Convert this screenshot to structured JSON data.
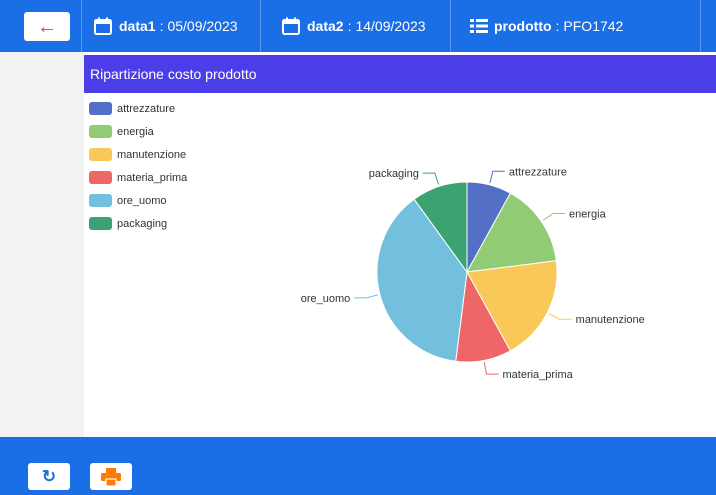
{
  "toolbar": {
    "back_icon": "arrow-left-icon",
    "date1": {
      "label": "data1",
      "value": "05/09/2023",
      "icon": "calendar-icon"
    },
    "date2": {
      "label": "data2",
      "value": "14/09/2023",
      "icon": "calendar-icon"
    },
    "product": {
      "label": "prodotto",
      "value": "PFO1742",
      "icon": "list-icon"
    }
  },
  "panel": {
    "title": "Ripartizione costo prodotto"
  },
  "chart_data": {
    "type": "pie",
    "title": "",
    "legend_placement": "top-left",
    "slices": [
      {
        "name": "attrezzature",
        "value": 8,
        "color": "#5470c6"
      },
      {
        "name": "energia",
        "value": 15,
        "color": "#91cc75"
      },
      {
        "name": "manutenzione",
        "value": 19,
        "color": "#fac858"
      },
      {
        "name": "materia_prima",
        "value": 10,
        "color": "#ee6666"
      },
      {
        "name": "ore_uomo",
        "value": 38,
        "color": "#73c0de"
      },
      {
        "name": "packaging",
        "value": 10,
        "color": "#3ba272"
      }
    ]
  },
  "footer": {
    "refresh_icon": "refresh-icon",
    "print_icon": "print-icon"
  },
  "colors": {
    "primary": "#1a6ee6",
    "header": "#4b3de8",
    "back_arrow": "#e53935",
    "print": "#ff7a00"
  }
}
